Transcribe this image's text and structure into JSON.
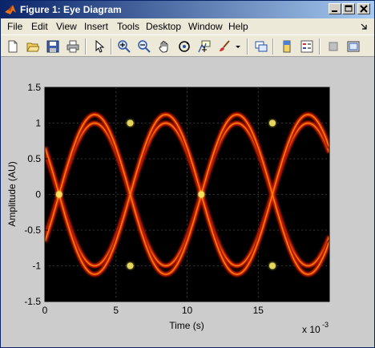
{
  "window": {
    "title": "Figure 1: Eye Diagram",
    "accent": "#0a246a"
  },
  "menu": {
    "items": [
      "File",
      "Edit",
      "View",
      "Insert",
      "Tools",
      "Desktop",
      "Window",
      "Help"
    ],
    "dock_icon": "dock-arrow-icon"
  },
  "toolbar": {
    "buttons": [
      "new-figure-icon",
      "open-file-icon",
      "save-icon",
      "print-icon",
      "pointer-icon",
      "zoom-in-icon",
      "zoom-out-icon",
      "pan-hand-icon",
      "rotate-3d-icon",
      "data-cursor-icon",
      "brush-icon",
      "link-plot-icon",
      "colorbar-icon",
      "legend-icon",
      "hide-plot-tools-icon",
      "show-plot-tools-icon"
    ]
  },
  "chart_data": {
    "type": "heatmap",
    "title": "",
    "xlabel": "Time (s)",
    "ylabel": "Amplitude (AU)",
    "x_exponent": "x 10",
    "x_exponent_power": "-3",
    "xlim": [
      0,
      0.02
    ],
    "ylim": [
      -1.5,
      1.5
    ],
    "xticks": [
      "0",
      "5",
      "10",
      "15"
    ],
    "yticks": [
      "1.5",
      "1",
      "0.5",
      "0",
      "-0.5",
      "-1",
      "-1.5"
    ],
    "grid": true,
    "colormap": "hot",
    "background": "#000000",
    "levels": [
      -1.12,
      -1.0,
      1.0,
      1.12
    ],
    "crossings_x": [
      0.001,
      0.006,
      0.011,
      0.016
    ],
    "period": 0.01
  }
}
